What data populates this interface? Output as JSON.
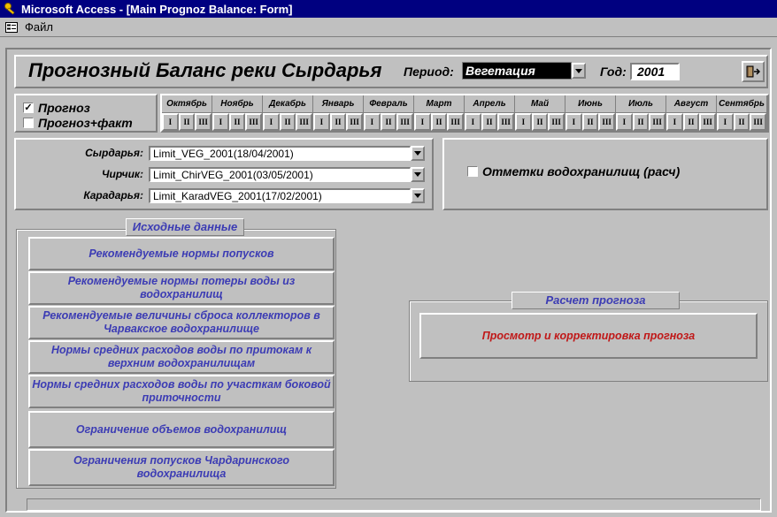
{
  "window": {
    "title": "Microsoft Access - [Main Prognoz Balance: Form]"
  },
  "menu": {
    "file": "Файл"
  },
  "header": {
    "title": "Прогнозный Баланс реки Сырдарья",
    "period_label": "Период:",
    "period_value": "Вегетация",
    "year_label": "Год:",
    "year_value": "2001"
  },
  "mode": {
    "forecast": {
      "label": "Прогноз",
      "checked": true
    },
    "forecast_fact": {
      "label": "Прогноз+факт",
      "checked": false
    }
  },
  "months": [
    "Октябрь",
    "Ноябрь",
    "Декабрь",
    "Январь",
    "Февраль",
    "Март",
    "Апрель",
    "Май",
    "Июнь",
    "Июль",
    "Август",
    "Сентябрь"
  ],
  "dekads": [
    "I",
    "II",
    "III"
  ],
  "rivers": [
    {
      "label": "Сырдарья:",
      "value": "Limit_VEG_2001(18/04/2001)"
    },
    {
      "label": "Чирчик:",
      "value": "Limit_ChirVEG_2001(03/05/2001)"
    },
    {
      "label": "Карадарья:",
      "value": "Limit_KaradVEG_2001(17/02/2001)"
    }
  ],
  "reservoir_marks": {
    "label": "Отметки водохранилищ (расч)",
    "checked": false
  },
  "source": {
    "title": "Исходные данные",
    "buttons": [
      "Рекомендуемые нормы попусков",
      "Рекомендуемые нормы потеры воды из водохранилищ",
      "Рекомендуемые величины сброса коллекторов в Чарвакское водохранилище",
      "Нормы средних расходов воды по притокам к верхним водохранилищам",
      "Нормы средних расходов воды по участкам боковой приточности",
      "Ограничение объемов водохранилищ",
      "Ограничения попусков Чардаринского водохранилища"
    ]
  },
  "calc": {
    "title": "Расчет прогноза",
    "button": "Просмотр и корректировка прогноза"
  },
  "colors": {
    "titlebar": "#000080",
    "face": "#c0c0c0",
    "blue_text": "#3c3cb4",
    "red_text": "#c01818"
  }
}
